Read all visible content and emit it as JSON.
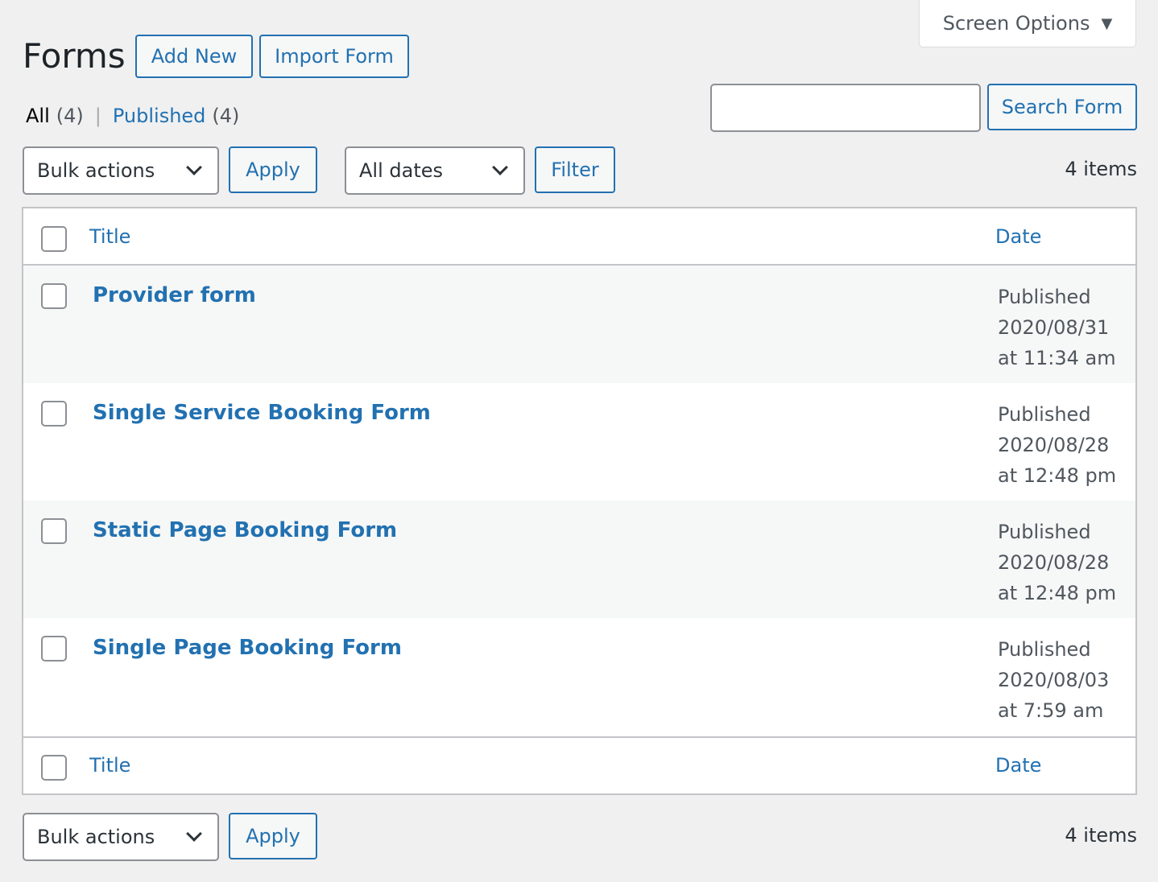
{
  "screen_options": {
    "label": "Screen Options",
    "caret": "▼"
  },
  "header": {
    "title": "Forms",
    "add_new": "Add New",
    "import": "Import Form"
  },
  "views": {
    "all_label": "All",
    "all_count": "(4)",
    "separator": "|",
    "published_label": "Published",
    "published_count": "(4)"
  },
  "search": {
    "value": "",
    "button": "Search Form"
  },
  "top_nav": {
    "bulk_actions": "Bulk actions",
    "apply": "Apply",
    "dates": "All dates",
    "filter": "Filter",
    "items": "4 items"
  },
  "bottom_nav": {
    "bulk_actions": "Bulk actions",
    "apply": "Apply",
    "items": "4 items"
  },
  "columns": {
    "title": "Title",
    "date": "Date"
  },
  "rows": [
    {
      "title": "Provider form",
      "status": "Published",
      "date": "2020/08/31",
      "time": "at 11:34 am"
    },
    {
      "title": "Single Service Booking Form",
      "status": "Published",
      "date": "2020/08/28",
      "time": "at 12:48 pm"
    },
    {
      "title": "Static Page Booking Form",
      "status": "Published",
      "date": "2020/08/28",
      "time": "at 12:48 pm"
    },
    {
      "title": "Single Page Booking Form",
      "status": "Published",
      "date": "2020/08/03",
      "time": "at 7:59 am"
    }
  ]
}
